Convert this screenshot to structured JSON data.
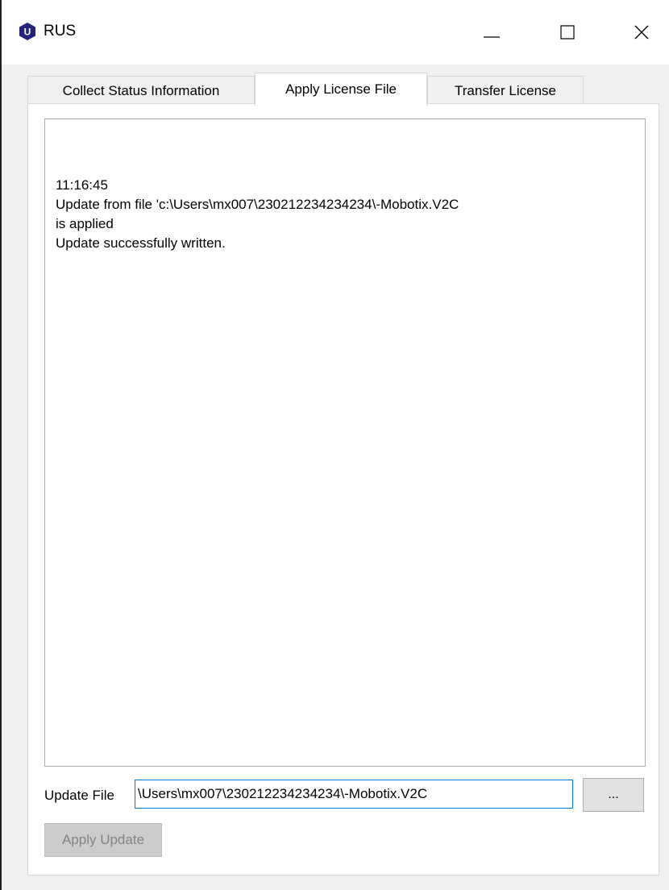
{
  "window": {
    "title": "RUS",
    "app_icon_letter": "U",
    "accent_color": "#23237a"
  },
  "tabs": [
    {
      "label": "Collect Status Information",
      "active": false
    },
    {
      "label": "Apply License File",
      "active": true
    },
    {
      "label": "Transfer License",
      "active": false
    }
  ],
  "log": {
    "lines": [
      "11:16:45",
      "Update from file 'c:\\Users\\mx007\\230212234234234\\-Mobotix.V2C",
      "is applied",
      "Update successfully written."
    ]
  },
  "update_file": {
    "label": "Update File",
    "value": "\\Users\\mx007\\230212234234234\\-Mobotix.V2C",
    "browse_label": "..."
  },
  "apply_button": {
    "label": "Apply Update",
    "enabled": false
  }
}
